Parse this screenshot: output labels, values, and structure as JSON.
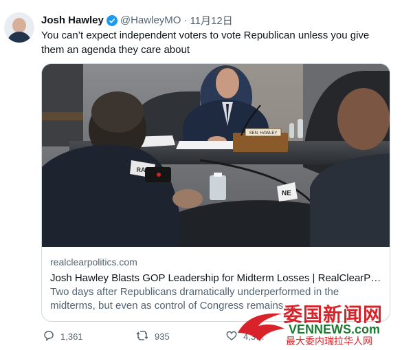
{
  "tweet": {
    "author_name": "Josh Hawley",
    "handle": "@HawleyMO",
    "separator": "·",
    "timestamp": "11月12日",
    "text": "You can’t expect independent voters to vote Republican unless you give them an agenda they care about"
  },
  "card": {
    "domain": "realclearpolitics.com",
    "title": "Josh Hawley Blasts GOP Leadership for Midterm Losses | RealClearPol…",
    "description": "Two days after Republicans dramatically underperformed in the midterms, but even as control of Congress remains …",
    "image_labels": {
      "nameplate": "SEN. HAWLEY",
      "left_sign": "RAS",
      "right_sign": "NE"
    }
  },
  "actions": {
    "reply_count": "1,361",
    "retweet_count": "935",
    "like_count": "4,3…"
  },
  "watermark": {
    "cn_title": "委国新闻网",
    "en_title": "VENNEWS.com",
    "cn_subtitle": "最大委内瑞拉华人网"
  },
  "colors": {
    "verified_blue": "#1d9bf0",
    "secondary_text": "#536471",
    "watermark_red": "#d8232a",
    "watermark_green": "#1b7a2f"
  }
}
